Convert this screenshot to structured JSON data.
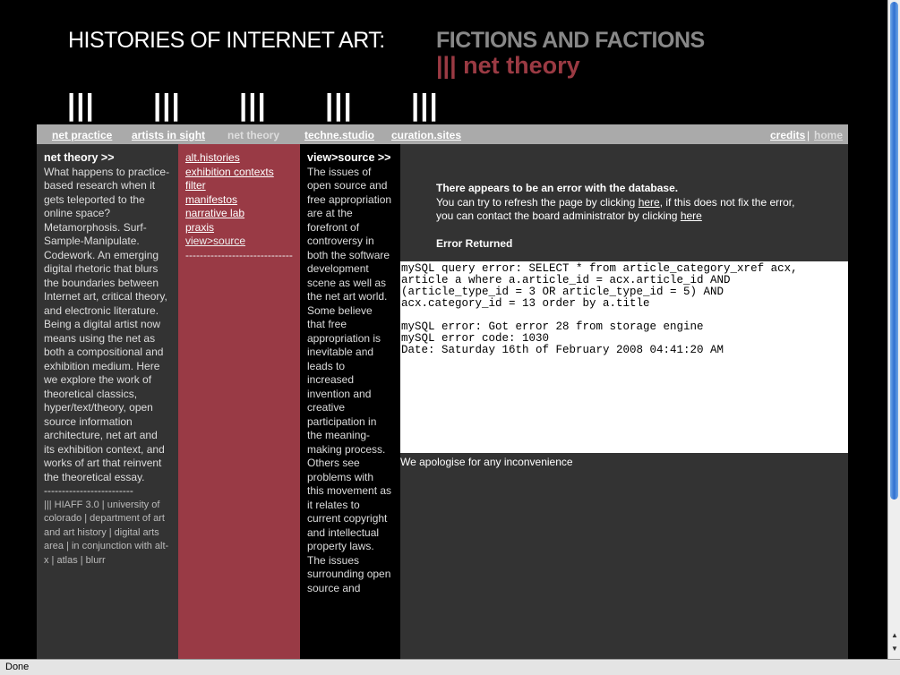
{
  "header": {
    "title_main": "HISTORIES OF INTERNET ART:",
    "title_sub": "FICTIONS AND FACTIONS",
    "section_title": "||| net theory",
    "bars": [
      "|||",
      "|||",
      "|||",
      "|||",
      "|||"
    ]
  },
  "nav": {
    "items": [
      "net practice",
      "artists in sight",
      "net theory",
      "techne.studio",
      "curation.sites"
    ],
    "current": "net theory",
    "credits": "credits",
    "separator": "|",
    "home": "home"
  },
  "col1": {
    "heading": "net theory >>",
    "text": "What happens to practice-based research when it gets teleported to the online space? Metamorphosis. Surf-Sample-Manipulate. Codework. An emerging digital rhetoric that blurs the boundaries between Internet art, critical theory, and electronic literature. Being a digital artist now means using the net as both a compositional and exhibition medium. Here we explore the work of theoretical classics, hyper/text/theory, open source information architecture, net art and its exhibition context, and works of art that reinvent the theoretical essay.",
    "dashes": "-------------------------",
    "footer": "||| HIAFF 3.0 | university of colorado | department of art and art history | digital arts area | in conjunction with alt-x | atlas | blurr"
  },
  "col2": {
    "links": [
      "alt.histories",
      "exhibition contexts",
      "filter",
      "manifestos",
      "narrative lab",
      "praxis",
      "view>source"
    ],
    "dashes": "-------------------------------------"
  },
  "col3": {
    "heading": "view>source >>",
    "text": "The issues of open source and free appropriation are at the forefront of controversy in both the software development scene as well as the net art world. Some believe that free appropriation is inevitable and leads to increased invention and creative participation in the meaning-making process. Others see problems with this movement as it relates to current copyright and intellectual property laws. The issues surrounding open source and"
  },
  "error": {
    "title": "There appears to be an error with the database.",
    "line1_a": "You can try to refresh the page by clicking ",
    "link1": "here",
    "line1_b": ", if this does not fix the error, you can contact the board administrator by clicking ",
    "link2": "here",
    "returned_label": "Error Returned",
    "sql_lines": "mySQL query error: SELECT * from article_category_xref acx,\narticle a where a.article_id = acx.article_id AND\n(article_type_id = 3 OR article_type_id = 5) AND\nacx.category_id = 13 order by a.title\n\nmySQL error: Got error 28 from storage engine\nmySQL error code: 1030\nDate: Saturday 16th of February 2008 04:41:20 AM",
    "apology": "We apologise for any inconvenience"
  },
  "statusbar": {
    "text": "Done"
  },
  "colors": {
    "accent_red": "#993a45",
    "nav_gray": "#aaaaaa",
    "panel_dark": "#333333"
  }
}
